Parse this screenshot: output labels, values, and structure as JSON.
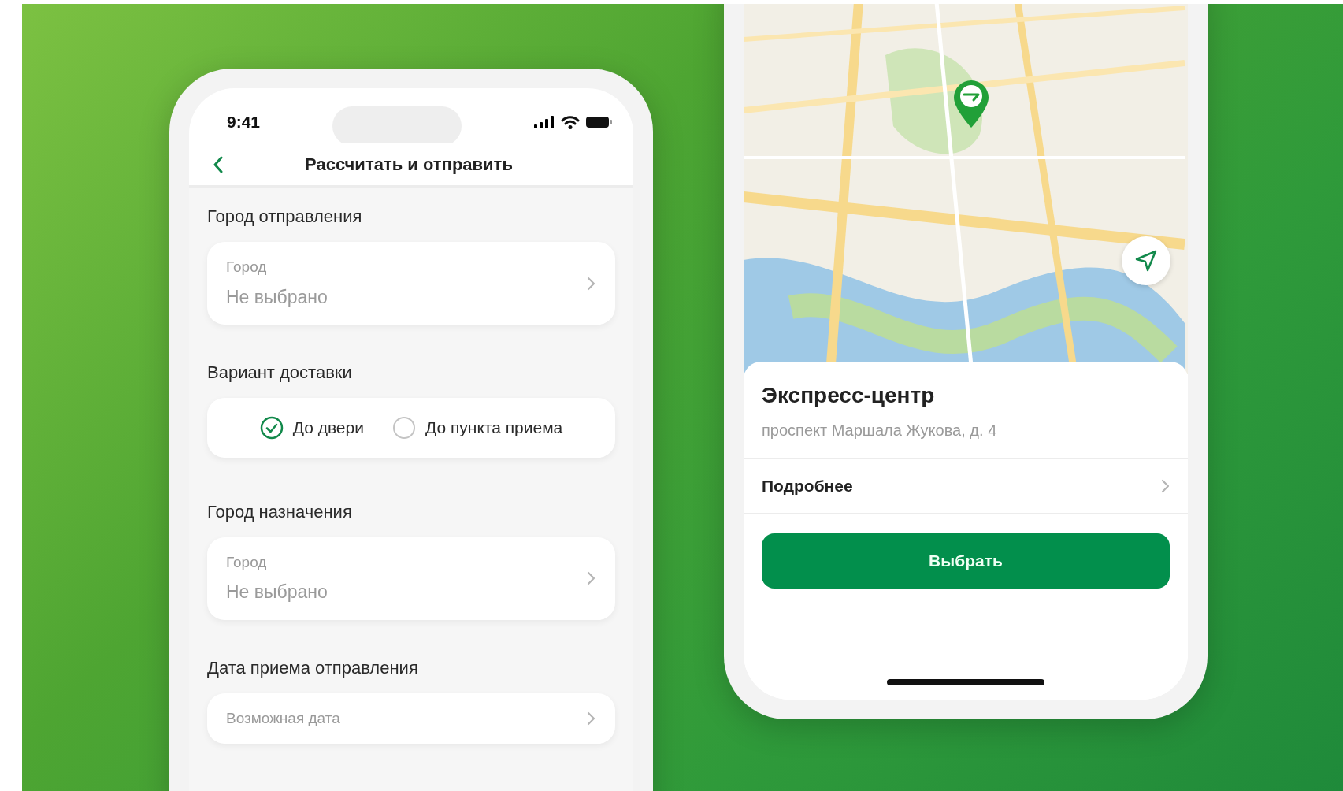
{
  "left_screen": {
    "status_bar": {
      "time": "9:41"
    },
    "header": {
      "title": "Рассчитать и отправить"
    },
    "sections": [
      {
        "kind": "picker",
        "title": "Город отправления",
        "label": "Город",
        "value": "Не выбрано"
      },
      {
        "kind": "radio",
        "title": "Вариант доставки",
        "options": [
          {
            "label": "До двери",
            "selected": true
          },
          {
            "label": "До пункта приема",
            "selected": false
          }
        ]
      },
      {
        "kind": "picker",
        "title": "Город назначения",
        "label": "Город",
        "value": "Не выбрано"
      },
      {
        "kind": "picker",
        "title": "Дата приема отправления",
        "label": "Возможная дата"
      }
    ]
  },
  "right_screen": {
    "place": {
      "name": "Экспресс-центр",
      "address": "проспект Маршала Жукова, д. 4"
    },
    "details_link": "Подробнее",
    "select_button": "Выбрать"
  }
}
